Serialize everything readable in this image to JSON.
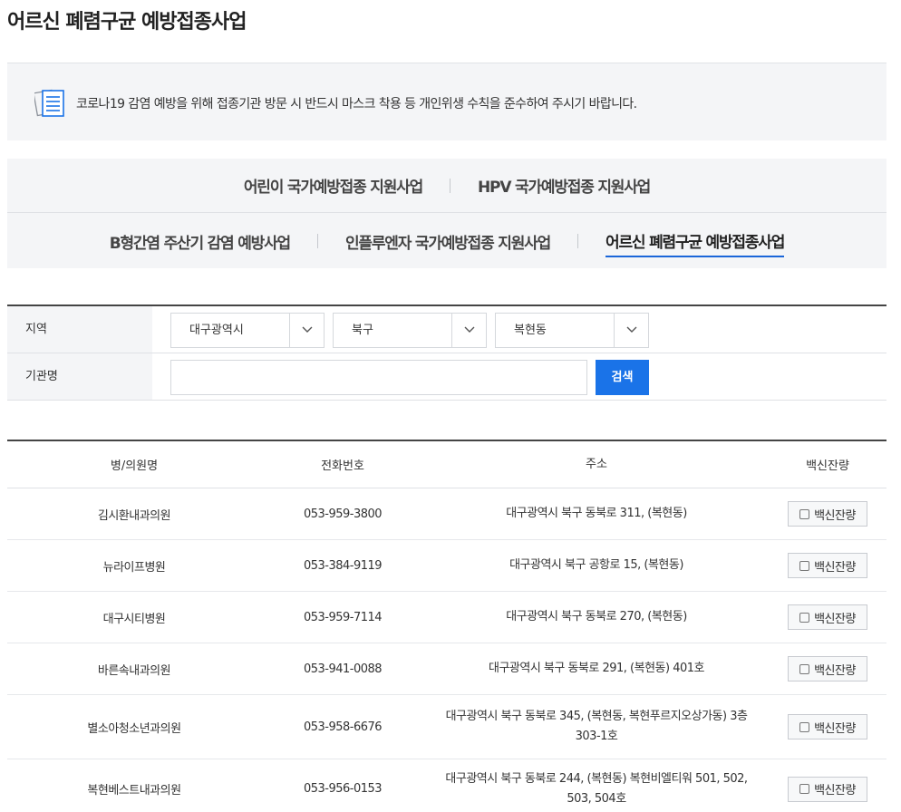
{
  "page": {
    "title": "어르신 폐렴구균 예방접종사업"
  },
  "notice": {
    "text": "코로나19 감염 예방을 위해 접종기관 방문 시 반드시 마스크 착용 등 개인위생 수칙을 준수하여 주시기 바랍니다.",
    "icon": "document-list-icon"
  },
  "tabs": {
    "row1": [
      "어린이 국가예방접종 지원사업",
      "HPV 국가예방접종 지원사업"
    ],
    "row2": [
      "B형간염 주산기 감염 예방사업",
      "인플루엔자 국가예방접종 지원사업",
      "어르신 폐렴구균 예방접종사업"
    ],
    "active": "어르신 폐렴구균 예방접종사업",
    "accent_color": "#1a66d9"
  },
  "search": {
    "region_label": "지역",
    "city": "대구광역시",
    "district": "북구",
    "dong": "복현동",
    "name_label": "기관명",
    "name_value": "",
    "button_label": "검색",
    "button_color": "#1a73e8"
  },
  "table": {
    "headers": [
      "병/의원명",
      "전화번호",
      "주소",
      "백신잔량"
    ],
    "rows": [
      {
        "name": "김시환내과의원",
        "phone": "053-959-3800",
        "address": "대구광역시 북구 동북로 311, (복현동)",
        "vaccine": "백신잔량"
      },
      {
        "name": "뉴라이프병원",
        "phone": "053-384-9119",
        "address": "대구광역시 북구 공항로 15, (복현동)",
        "vaccine": "백신잔량"
      },
      {
        "name": "대구시티병원",
        "phone": "053-959-7114",
        "address": "대구광역시 북구 동북로 270, (복현동)",
        "vaccine": "백신잔량"
      },
      {
        "name": "바른속내과의원",
        "phone": "053-941-0088",
        "address": "대구광역시 북구 동북로 291, (복현동) 401호",
        "vaccine": "백신잔량"
      },
      {
        "name": "별소아청소년과의원",
        "phone": "053-958-6676",
        "address": "대구광역시 북구 동북로 345, (복현동, 복현푸르지오상가동) 3층 303-1호",
        "vaccine": "백신잔량"
      },
      {
        "name": "복현베스트내과의원",
        "phone": "053-956-0153",
        "address": "대구광역시 북구 동북로 244, (복현동) 복현비엘티워 501, 502, 503, 504호",
        "vaccine": "백신잔량"
      }
    ]
  }
}
